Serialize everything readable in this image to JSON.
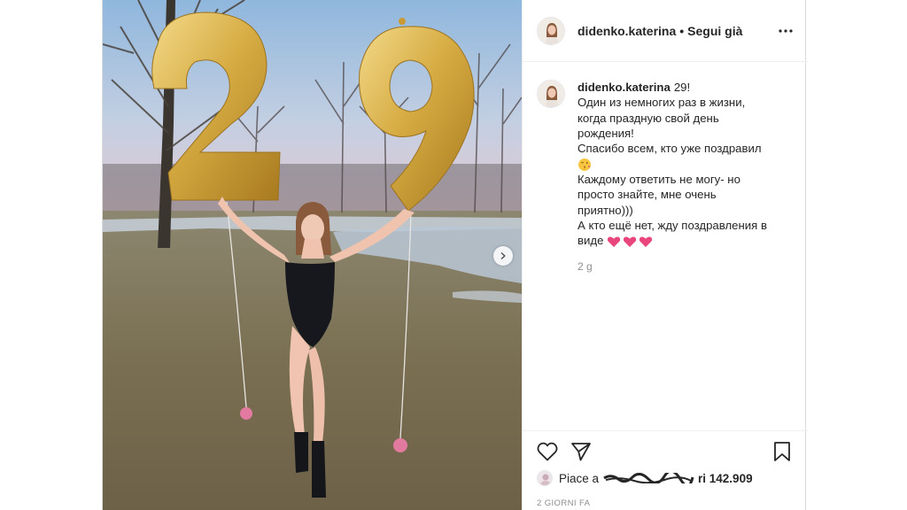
{
  "post": {
    "username": "didenko.katerina",
    "separator": "•",
    "follow_status": "Segui già",
    "caption_lines": [
      "29!",
      "Один из немногих раз в жизни,",
      "когда праздную свой день",
      "рождения!",
      "Спасибо всем, кто уже поздравил",
      "Каждому ответить не могу- но",
      "просто знайте, мне очень",
      "приятно)))",
      "А кто ещё нет, жду поздравления в",
      "виде"
    ],
    "caption_timestamp": "2 g",
    "likes_prefix": "Piace a",
    "likes_suffix": "ri 142.909",
    "time_ago": "2 GIORNI FA"
  },
  "media": {
    "balloon_number": "29",
    "balloon_color": "#d9b24a"
  },
  "icons": {
    "more": "more-options-icon",
    "like": "heart-outline-icon",
    "share": "paper-plane-icon",
    "save": "bookmark-outline-icon",
    "next": "chevron-right-icon"
  },
  "colors": {
    "text": "#262626",
    "muted": "#8e8e8e",
    "border": "#efefef",
    "heart_emoji": "#e8467c"
  }
}
